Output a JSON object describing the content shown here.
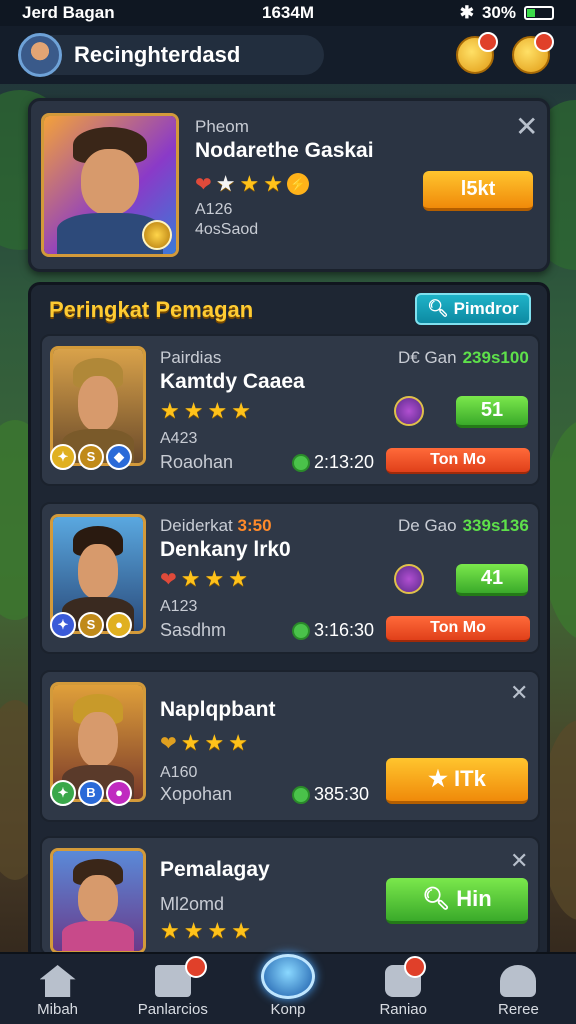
{
  "status_bar": {
    "carrier": "Jerd Bagan",
    "time": "1634M",
    "battery": "30%",
    "battery_level": 0.3
  },
  "header": {
    "player_name": "Recinghterdasd"
  },
  "featured": {
    "subtitle": "Pheom",
    "name": "Nodarethe Gaskai",
    "stars": 3,
    "id_line": "A126",
    "status_line": "4osSaod",
    "button": "l5kt"
  },
  "panel": {
    "title": "Peringkat Pemagan",
    "button": "Pimdror"
  },
  "entries": [
    {
      "subtitle": "Pairdias",
      "name": "Kamtdy Caaea",
      "stars": 4,
      "id_line": "A423",
      "location": "Roaohan",
      "score_label": "D€ Gan",
      "score_value": "239s100",
      "level": "51",
      "timer": "2:13:20",
      "action": "Ton Mo"
    },
    {
      "subtitle": "Deiderkat",
      "subtitle_accent": "3:50",
      "name": "Denkany lrk0",
      "stars": 3,
      "id_line": "A123",
      "location": "Sasdhm",
      "score_label": "De Gao",
      "score_value": "339s136",
      "level": "41",
      "timer": "3:16:30",
      "action": "Ton Mo"
    },
    {
      "name": "Naplqpbant",
      "stars": 3,
      "id_line": "A160",
      "location": "Xopohan",
      "timer": "385:30",
      "action": "ITk"
    },
    {
      "name": "Pemalagay",
      "subtitle": "Ml2omd",
      "stars": 4,
      "action": "Hin"
    }
  ],
  "nav": [
    {
      "label": "Mibah",
      "icon": "home-icon"
    },
    {
      "label": "Panlarcios",
      "icon": "cards-icon"
    },
    {
      "label": "Konp",
      "icon": "crystal-icon"
    },
    {
      "label": "Raniao",
      "icon": "camera-icon"
    },
    {
      "label": "Reree",
      "icon": "profile-icon"
    }
  ]
}
